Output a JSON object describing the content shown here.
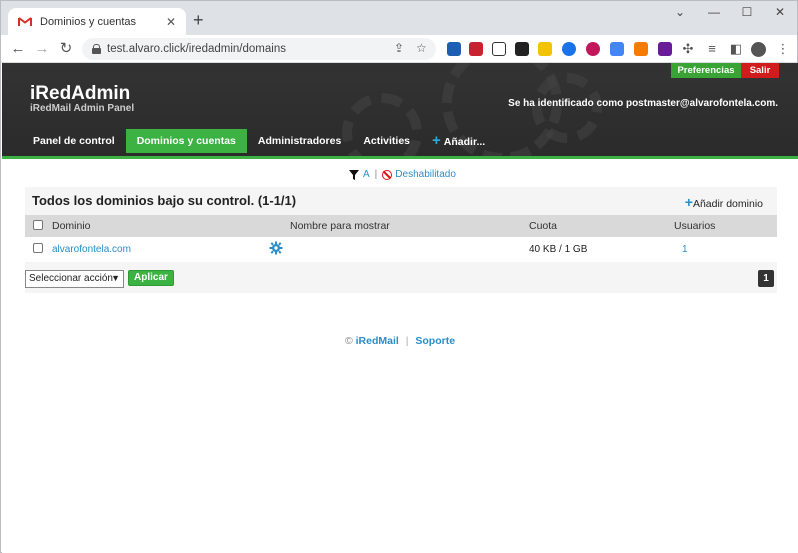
{
  "browser": {
    "tab_title": "Dominios y cuentas",
    "url": "test.alvaro.click/iredadmin/domains"
  },
  "header": {
    "brand": "iRedAdmin",
    "subtitle": "iRedMail Admin Panel",
    "login_info": "Se ha identificado como postmaster@alvarofontela.com.",
    "preferences_label": "Preferencias",
    "logout_label": "Salir"
  },
  "nav": {
    "items": [
      {
        "label": "Panel de control"
      },
      {
        "label": "Dominios y cuentas"
      },
      {
        "label": "Administradores"
      },
      {
        "label": "Activities"
      },
      {
        "label": "Añadir..."
      }
    ]
  },
  "filter": {
    "letter": "A",
    "disabled_label": "Deshabilitado"
  },
  "panel": {
    "title": "Todos los dominios bajo su control. (1-1/1)",
    "add_domain_label": "Añadir dominio",
    "columns": [
      "Dominio",
      "Nombre para mostrar",
      "Cuota",
      "Usuarios"
    ],
    "rows": [
      {
        "domain": "alvarofontela.com",
        "display_name": "",
        "quota": "40 KB / 1 GB",
        "users": "1"
      }
    ],
    "action_select": "Seleccionar acción",
    "apply_label": "Aplicar",
    "page": "1"
  },
  "footer": {
    "copyright": "©",
    "iredmail_link": "iRedMail",
    "support_link": "Soporte"
  },
  "colors": {
    "accent_green": "#3bb241",
    "logout_red": "#d01c1c",
    "link_blue": "#2a8ec9",
    "header_dark": "#2f2f2f"
  }
}
